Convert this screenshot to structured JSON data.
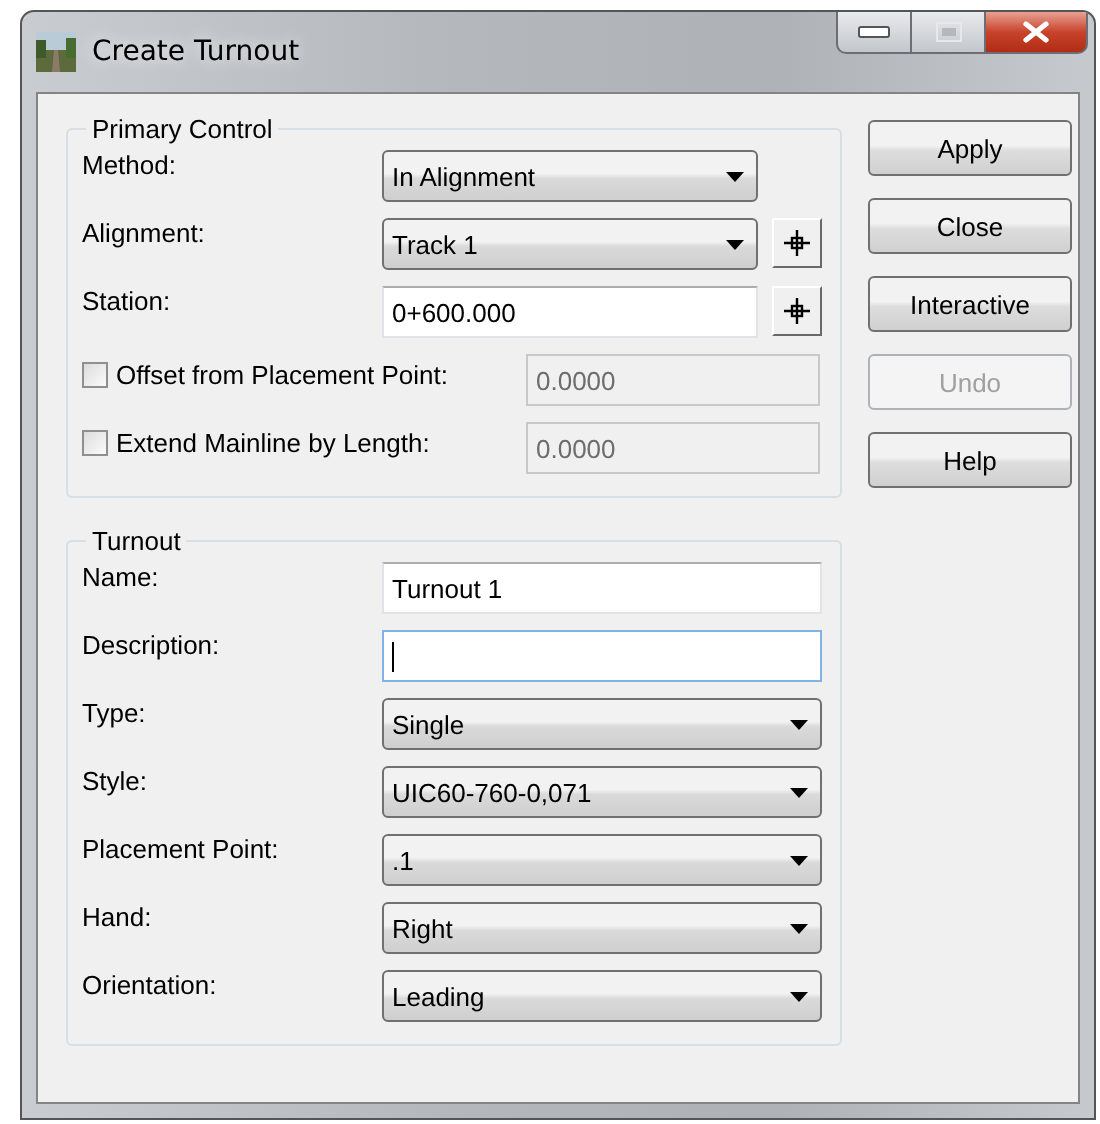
{
  "window": {
    "title": "Create Turnout"
  },
  "primary_control": {
    "title": "Primary Control",
    "fields": [
      {
        "kind": "dropdown",
        "label": "Method:",
        "value": "In Alignment",
        "picker": false
      },
      {
        "kind": "dropdown",
        "label": "Alignment:",
        "value": "Track 1",
        "picker": true
      },
      {
        "kind": "text",
        "label": "Station:",
        "value": "0+600.000",
        "picker": true,
        "focused": false
      },
      {
        "kind": "checkbox",
        "label": "Offset from Placement Point:",
        "checked": false,
        "value": "0.0000",
        "disabled": true
      },
      {
        "kind": "checkbox",
        "label": "Extend Mainline by Length:",
        "checked": false,
        "value": "0.0000",
        "disabled": true
      }
    ]
  },
  "turnout": {
    "title": "Turnout",
    "fields": [
      {
        "kind": "text",
        "label": "Name:",
        "value": "Turnout 1",
        "focused": false
      },
      {
        "kind": "text",
        "label": "Description:",
        "focused": true
      },
      {
        "kind": "dropdown",
        "label": "Type:",
        "value": "Single"
      },
      {
        "kind": "dropdown",
        "label": "Style:",
        "value": "UIC60-760-0,071"
      },
      {
        "kind": "dropdown",
        "label": "Placement Point:",
        "value": ".1"
      },
      {
        "kind": "dropdown",
        "label": "Hand:",
        "value": "Right"
      },
      {
        "kind": "dropdown",
        "label": "Orientation:",
        "value": "Leading"
      }
    ]
  },
  "buttons": [
    {
      "label": "Apply",
      "disabled": false
    },
    {
      "label": "Close",
      "disabled": false
    },
    {
      "label": "Interactive",
      "disabled": false
    },
    {
      "label": "Undo",
      "disabled": true
    },
    {
      "label": "Help",
      "disabled": false
    }
  ]
}
